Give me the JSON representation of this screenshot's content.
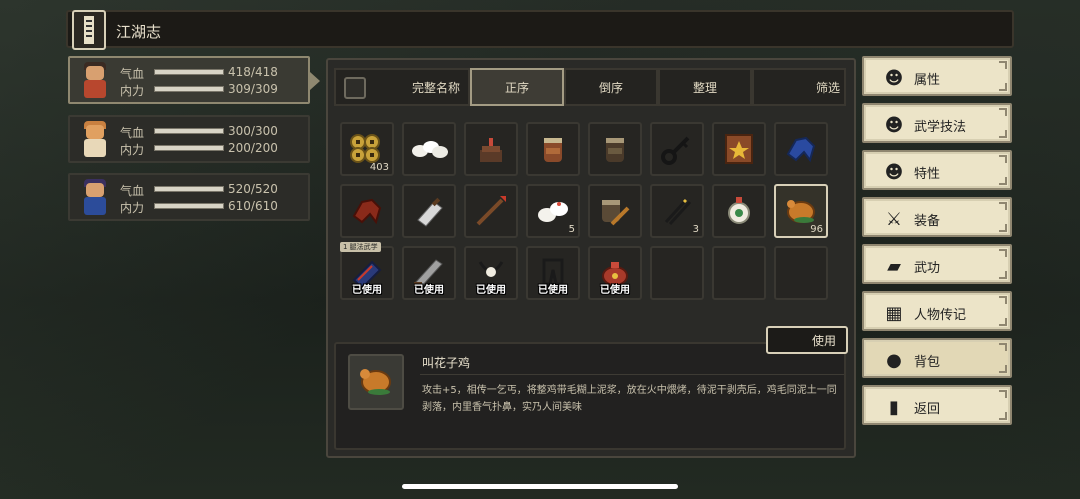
{
  "title": "江湖志",
  "characters": [
    {
      "hp_label": "气血",
      "hp": "418/418",
      "hp_fraction": 1.0,
      "mp_label": "内力",
      "mp": "309/309",
      "mp_fraction": 1.0,
      "active": true
    },
    {
      "hp_label": "气血",
      "hp": "300/300",
      "hp_fraction": 1.0,
      "mp_label": "内力",
      "mp": "200/200",
      "mp_fraction": 1.0,
      "active": false
    },
    {
      "hp_label": "气血",
      "hp": "520/520",
      "hp_fraction": 1.0,
      "mp_label": "内力",
      "mp": "610/610",
      "mp_fraction": 1.0,
      "active": false
    }
  ],
  "tabs": {
    "full_name": "完整名称",
    "asc": "正序",
    "desc": "倒序",
    "tidy": "整理",
    "filter": "筛选",
    "selected": "正序"
  },
  "inventory": {
    "row1": [
      {
        "icon": "coins-icon",
        "count": "403"
      },
      {
        "icon": "rice-buns-icon",
        "count": ""
      },
      {
        "icon": "incense-burner-icon",
        "count": ""
      },
      {
        "icon": "wine-jar-icon",
        "count": ""
      },
      {
        "icon": "clay-jar-icon",
        "count": ""
      },
      {
        "icon": "key-icon",
        "count": ""
      },
      {
        "icon": "martial-scroll-icon",
        "count": ""
      },
      {
        "icon": "blue-glove-icon",
        "count": ""
      }
    ],
    "row2": [
      {
        "icon": "red-glove-icon",
        "count": ""
      },
      {
        "icon": "cleaver-icon",
        "count": ""
      },
      {
        "icon": "spear-icon",
        "count": ""
      },
      {
        "icon": "steamed-buns-icon",
        "count": "5"
      },
      {
        "icon": "jar-with-stick-icon",
        "count": ""
      },
      {
        "icon": "chopsticks-icon",
        "count": "3"
      },
      {
        "icon": "pendant-icon",
        "count": ""
      },
      {
        "icon": "roast-chicken-icon",
        "count": "96"
      }
    ],
    "row3": [
      {
        "icon": "manual-book-icon",
        "used": "已使用",
        "tag": "1 腿法武学"
      },
      {
        "icon": "broadsword-icon",
        "used": "已使用"
      },
      {
        "icon": "necklace-icon",
        "used": "已使用"
      },
      {
        "icon": "pants-icon",
        "used": "已使用"
      },
      {
        "icon": "pouch-icon",
        "used": "已使用"
      }
    ]
  },
  "detail": {
    "use_label": "使用",
    "name": "叫花子鸡",
    "description": "攻击+5，相传一乞丐，将整鸡带毛糊上泥浆，放在火中煨烤，待泥干剥壳后，鸡毛同泥土一同剥落，内里香气扑鼻，实乃人间美味"
  },
  "menu": [
    {
      "label": "属性",
      "icon": "character-icon"
    },
    {
      "label": "武学技法",
      "icon": "martial-artist-icon"
    },
    {
      "label": "特性",
      "icon": "trait-icon"
    },
    {
      "label": "装备",
      "icon": "sword-icon"
    },
    {
      "label": "武功",
      "icon": "book-icon"
    },
    {
      "label": "人物传记",
      "icon": "biography-icon"
    },
    {
      "label": "背包",
      "icon": "backpack-icon"
    },
    {
      "label": "返回",
      "icon": "door-icon"
    }
  ]
}
